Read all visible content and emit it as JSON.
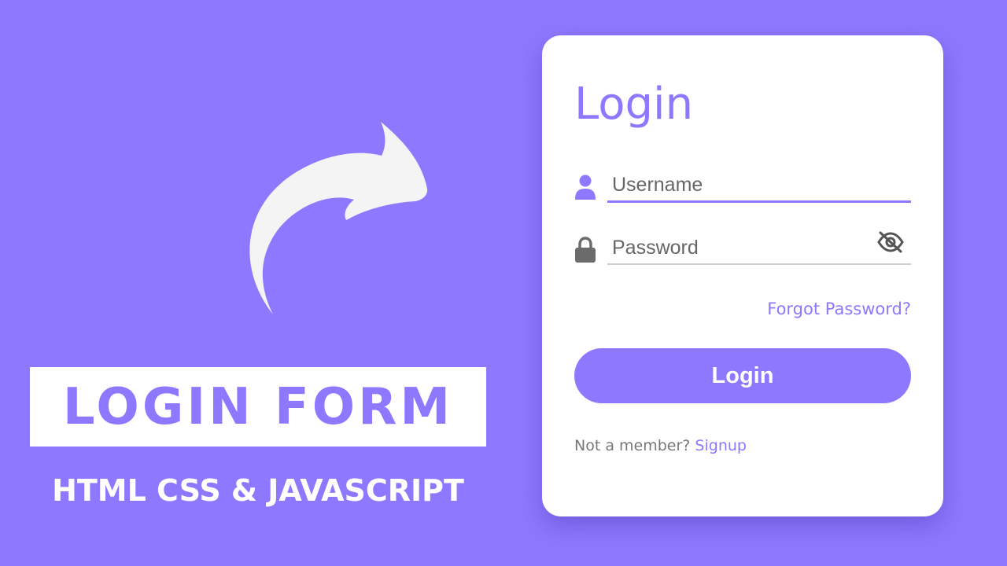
{
  "banner": {
    "title": "LOGIN FORM",
    "subtitle": "HTML CSS & JAVASCRIPT"
  },
  "decor": {
    "arrow_icon": "curved-arrow-icon"
  },
  "login_card": {
    "title": "Login",
    "username": {
      "placeholder": "Username",
      "value": "",
      "icon": "user-icon"
    },
    "password": {
      "placeholder": "Password",
      "value": "",
      "icon": "lock-icon",
      "toggle_icon": "eye-slash-icon"
    },
    "forgot_label": "Forgot Password?",
    "submit_label": "Login",
    "signup_prompt": "Not a member?",
    "signup_label": "Signup"
  },
  "colors": {
    "background": "#8e78ff",
    "accent": "#8e78ff",
    "card": "#ffffff",
    "icon_gray": "#6b6b6b"
  }
}
